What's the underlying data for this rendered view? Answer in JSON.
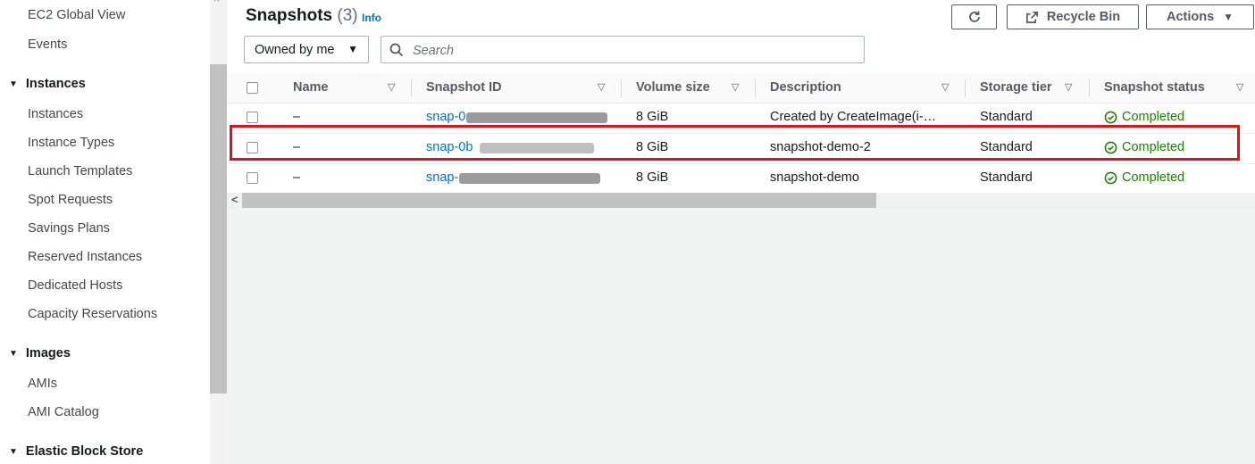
{
  "sidebar": {
    "items": [
      "EC2 Global View",
      "Events"
    ],
    "sections": [
      {
        "label": "Instances",
        "items": [
          "Instances",
          "Instance Types",
          "Launch Templates",
          "Spot Requests",
          "Savings Plans",
          "Reserved Instances",
          "Dedicated Hosts",
          "Capacity Reservations"
        ]
      },
      {
        "label": "Images",
        "items": [
          "AMIs",
          "AMI Catalog"
        ]
      },
      {
        "label": "Elastic Block Store",
        "items": []
      }
    ]
  },
  "header": {
    "title": "Snapshots",
    "count": "(3)",
    "info": "Info",
    "refresh_icon": "refresh-icon",
    "recycle_bin": "Recycle Bin",
    "actions": "Actions"
  },
  "filter": {
    "owner_selected": "Owned by me",
    "search_placeholder": "Search"
  },
  "table": {
    "columns": [
      "Name",
      "Snapshot ID",
      "Volume size",
      "Description",
      "Storage tier",
      "Snapshot status"
    ],
    "rows": [
      {
        "name": "–",
        "snapshot_id": "snap-0",
        "volume_size": "8 GiB",
        "description": "Created by CreateImage(i-…",
        "storage_tier": "Standard",
        "status": "Completed"
      },
      {
        "name": "–",
        "snapshot_id": "snap-0b",
        "volume_size": "8 GiB",
        "description": "snapshot-demo-2",
        "storage_tier": "Standard",
        "status": "Completed"
      },
      {
        "name": "–",
        "snapshot_id": "snap-",
        "volume_size": "8 GiB",
        "description": "snapshot-demo",
        "storage_tier": "Standard",
        "status": "Completed"
      }
    ]
  },
  "colors": {
    "link": "#0073bb",
    "success": "#1d8102",
    "highlight": "#e0121a"
  }
}
